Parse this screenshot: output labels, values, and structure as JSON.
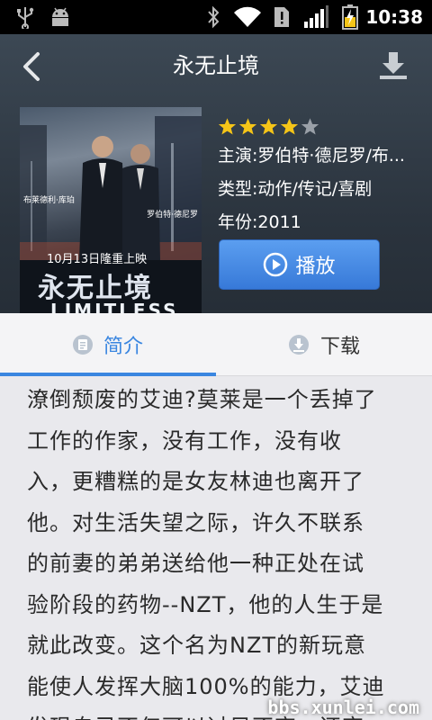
{
  "status_bar": {
    "time": "10:38",
    "icons": [
      "usb-icon",
      "android-debug-icon",
      "bluetooth-icon",
      "wifi-icon",
      "notification-icon",
      "signal-icon",
      "battery-charging-icon"
    ]
  },
  "header": {
    "title": "永无止境",
    "back_icon": "chevron-left-icon",
    "download_icon": "download-icon"
  },
  "movie": {
    "rating": {
      "filled": 4,
      "total": 5
    },
    "cast": "主演:罗伯特·德尼罗/布...",
    "genre": "类型:动作/传记/喜剧",
    "year": "年份:2011",
    "play_label": "播放",
    "poster_text": {
      "name_left": "布莱德利·库珀",
      "name_right": "罗伯特·德尼罗",
      "release": "10月13日隆重上映",
      "title_cn": "永无止境",
      "title_en": "LIMITLESS"
    }
  },
  "tabs": {
    "intro_label": "简介",
    "download_label": "下载",
    "active": "intro"
  },
  "synopsis": {
    "lines": [
      "潦倒颓废的艾迪?莫莱是一个丢掉了",
      "工作的作家，没有工作，没有收",
      "入，更糟糕的是女友林迪也离开了",
      "他。对生活失望之际，许久不联系",
      "的前妻的弟弟送给他一种正处在试",
      "验阶段的药物--NZT，他的人生于是",
      "就此改变。这个名为NZT的新玩意",
      "能使人发挥大脑100%的能力，艾迪",
      "发现自己不仅可以过目不忘，还变"
    ]
  },
  "watermark": "bbs.xunlei.com",
  "colors": {
    "accent": "#3a86e0",
    "header_bg": "#2f3842",
    "star": "#f5c518",
    "star_empty": "#9aa0a8"
  }
}
